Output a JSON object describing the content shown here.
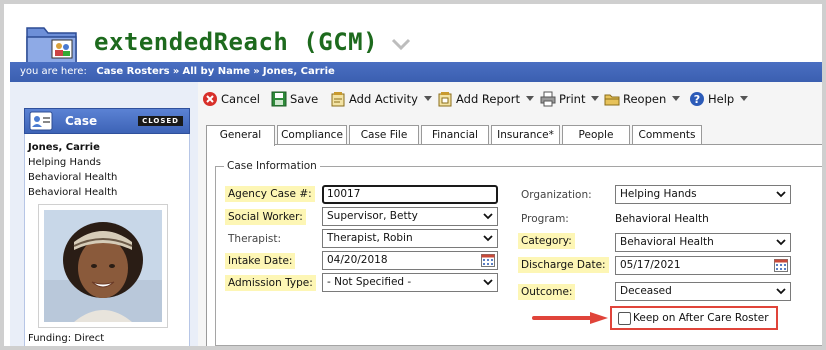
{
  "app": {
    "title": "extendedReach (GCM)"
  },
  "breadcrumb": {
    "prefix": "you are here:",
    "items": [
      "Case Rosters",
      "All by Name",
      "Jones, Carrie"
    ],
    "separator": "»"
  },
  "left_panel": {
    "header_title": "Case",
    "status_badge": "CLOSED",
    "patient_name": "Jones, Carrie",
    "lines": [
      "Helping Hands",
      "Behavioral Health",
      "Behavioral Health"
    ],
    "funding": "Funding: Direct"
  },
  "toolbar": {
    "cancel": "Cancel",
    "save": "Save",
    "add_activity": "Add Activity",
    "add_report": "Add Report",
    "print": "Print",
    "reopen": "Reopen",
    "help": "Help"
  },
  "tabs": [
    "General",
    "Compliance",
    "Case File",
    "Financial",
    "Insurance*",
    "People",
    "Comments"
  ],
  "form": {
    "legend": "Case Information",
    "agency_case_label": "Agency Case #:",
    "agency_case_value": "10017",
    "social_worker_label": "Social Worker:",
    "social_worker_value": "Supervisor, Betty",
    "therapist_label": "Therapist:",
    "therapist_value": "Therapist, Robin",
    "intake_label": "Intake Date:",
    "intake_value": "04/20/2018",
    "admission_label": "Admission Type:",
    "admission_value": "- Not Specified -",
    "organization_label": "Organization:",
    "organization_value": "Helping Hands",
    "program_label": "Program:",
    "program_value": "Behavioral Health",
    "category_label": "Category:",
    "category_value": "Behavioral Health",
    "discharge_label": "Discharge Date:",
    "discharge_value": "05/17/2021",
    "outcome_label": "Outcome:",
    "outcome_value": "Deceased",
    "keep_label": "Keep on After Care Roster"
  },
  "colors": {
    "title_green": "#1d6a1d",
    "breadcrumb_blue": "#3b5fb0",
    "required_yellow": "#fdf6b5",
    "highlight_red": "#e0443a"
  }
}
